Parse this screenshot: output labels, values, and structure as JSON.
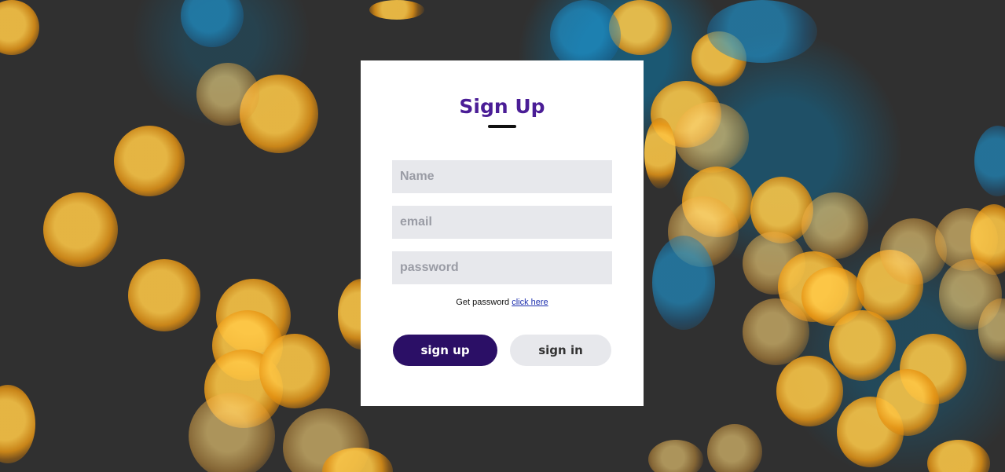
{
  "form": {
    "title": "Sign Up",
    "name_placeholder": "Name",
    "email_placeholder": "email",
    "password_placeholder": "password",
    "hint_text": "Get password ",
    "hint_link": "click here",
    "signup_label": "sign up",
    "signin_label": "sign in"
  },
  "colors": {
    "title": "#4a1d96",
    "primary_button": "#2b0f66",
    "secondary_button": "#e7e8ec",
    "input_background": "#e7e8ec",
    "link": "#1d2fae"
  },
  "background": {
    "description_icon": "bokeh-lights-icon"
  }
}
